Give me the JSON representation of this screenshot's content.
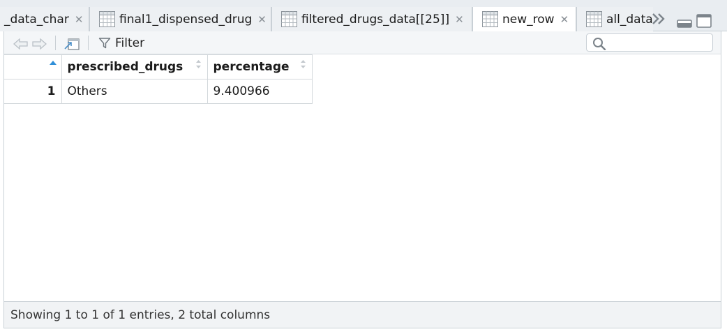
{
  "tabs": [
    {
      "label": "_data_char",
      "active": false
    },
    {
      "label": "final1_dispensed_drug",
      "active": false
    },
    {
      "label": "filtered_drugs_data[[25]]",
      "active": false
    },
    {
      "label": "new_row",
      "active": true
    },
    {
      "label": "all_data",
      "active": false
    }
  ],
  "toolbar": {
    "filter_label": "Filter",
    "search_placeholder": "",
    "search_value": ""
  },
  "table": {
    "columns": [
      {
        "label": ""
      },
      {
        "label": "prescribed_drugs"
      },
      {
        "label": "percentage"
      }
    ],
    "rows": [
      {
        "index": "1",
        "prescribed_drugs": "Others",
        "percentage": "9.400966"
      }
    ]
  },
  "status": {
    "text": "Showing 1 to 1 of 1 entries, 2 total columns"
  },
  "icons": {
    "tab": "table-grid-icon",
    "close": "close-icon",
    "overflow": "double-chevron-right-icon",
    "back": "back-arrow-icon",
    "forward": "forward-arrow-icon",
    "popout": "popout-window-icon",
    "filter": "funnel-icon",
    "search": "search-icon"
  },
  "colors": {
    "sort_active": "#2f8fd8",
    "tab_bg": "#e9edf1",
    "active_tab_bg": "#ffffff"
  }
}
